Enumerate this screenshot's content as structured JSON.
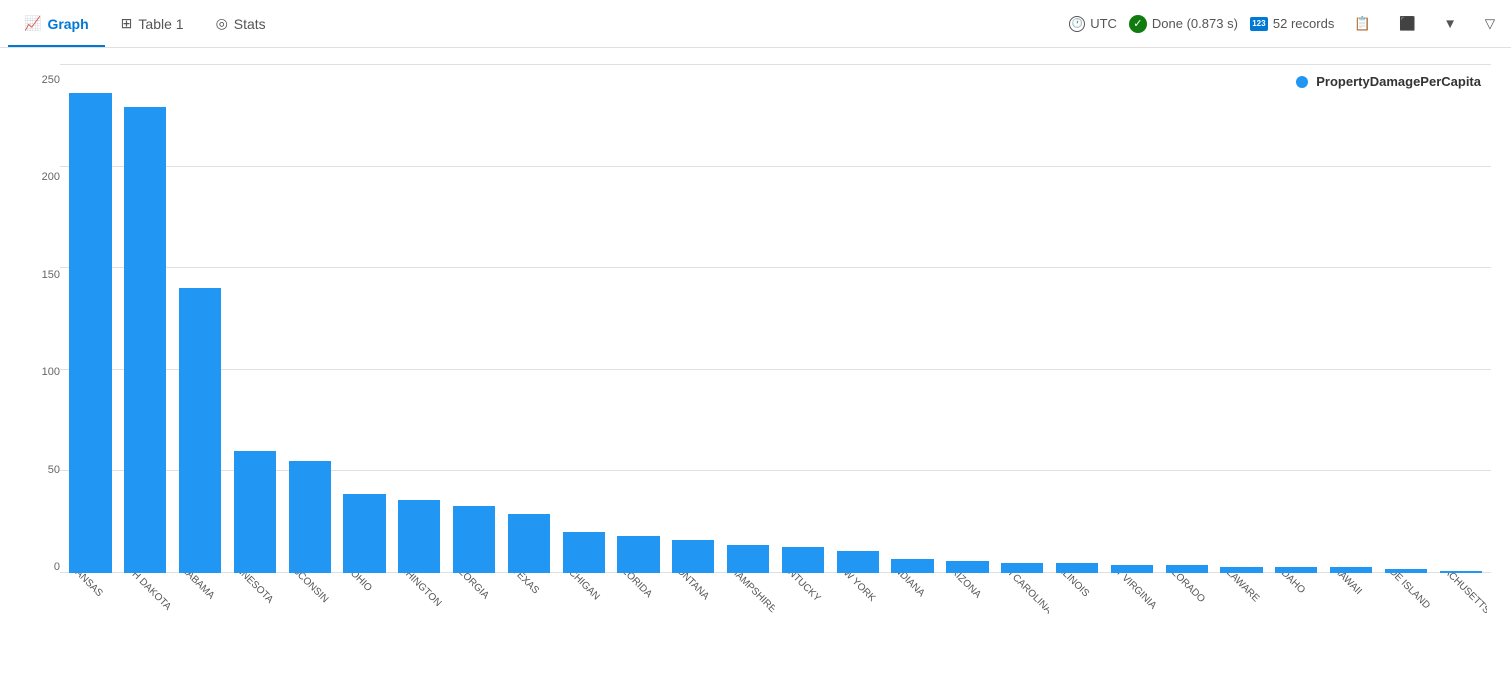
{
  "tabs": [
    {
      "id": "graph",
      "label": "Graph",
      "icon": "📈",
      "active": true
    },
    {
      "id": "table",
      "label": "Table 1",
      "icon": "⊞",
      "active": false
    },
    {
      "id": "stats",
      "label": "Stats",
      "icon": "◎",
      "active": false
    }
  ],
  "status": {
    "utc_label": "UTC",
    "done_label": "Done (0.873 s)",
    "records_label": "52 records"
  },
  "legend": {
    "label": "PropertyDamagePerCapita"
  },
  "chart": {
    "y_labels": [
      "0",
      "50",
      "100",
      "150",
      "200",
      "250"
    ],
    "max_value": 250,
    "bars": [
      {
        "state": "KANSAS",
        "value": 236
      },
      {
        "state": "NORTH DAKOTA",
        "value": 229
      },
      {
        "state": "ALABAMA",
        "value": 140
      },
      {
        "state": "MINNESOTA",
        "value": 60
      },
      {
        "state": "WISCONSIN",
        "value": 55
      },
      {
        "state": "OHIO",
        "value": 39
      },
      {
        "state": "WASHINGTON",
        "value": 36
      },
      {
        "state": "GEORGIA",
        "value": 33
      },
      {
        "state": "TEXAS",
        "value": 29
      },
      {
        "state": "MICHIGAN",
        "value": 20
      },
      {
        "state": "FLORIDA",
        "value": 18
      },
      {
        "state": "MONTANA",
        "value": 16
      },
      {
        "state": "NEW HAMPSHIRE",
        "value": 14
      },
      {
        "state": "KENTUCKY",
        "value": 13
      },
      {
        "state": "NEW YORK",
        "value": 11
      },
      {
        "state": "INDIANA",
        "value": 7
      },
      {
        "state": "ARIZONA",
        "value": 6
      },
      {
        "state": "SOUTH CAROLINA",
        "value": 5
      },
      {
        "state": "ILLINOIS",
        "value": 5
      },
      {
        "state": "WEST VIRGINIA",
        "value": 4
      },
      {
        "state": "COLORADO",
        "value": 4
      },
      {
        "state": "DELAWARE",
        "value": 3
      },
      {
        "state": "IDAHO",
        "value": 3
      },
      {
        "state": "HAWAII",
        "value": 3
      },
      {
        "state": "RHODE ISLAND",
        "value": 2
      },
      {
        "state": "MASSACHUSETTS",
        "value": 1
      }
    ]
  }
}
